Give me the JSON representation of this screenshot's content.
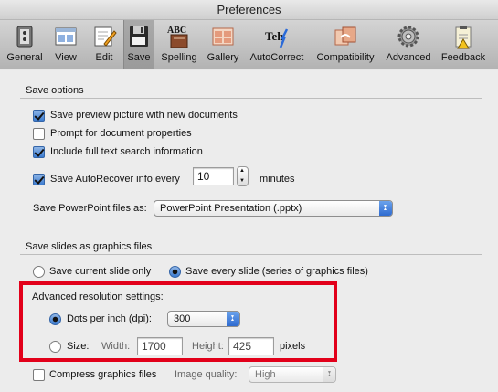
{
  "window": {
    "title": "Preferences"
  },
  "toolbar": {
    "items": [
      {
        "label": "General",
        "icon": "general-icon"
      },
      {
        "label": "View",
        "icon": "view-icon"
      },
      {
        "label": "Edit",
        "icon": "edit-icon"
      },
      {
        "label": "Save",
        "icon": "save-icon",
        "selected": true
      },
      {
        "label": "Spelling",
        "icon": "spelling-icon"
      },
      {
        "label": "Gallery",
        "icon": "gallery-icon"
      },
      {
        "label": "AutoCorrect",
        "icon": "autocorrect-icon"
      },
      {
        "label": "Compatibility",
        "icon": "compatibility-icon"
      },
      {
        "label": "Advanced",
        "icon": "advanced-icon"
      },
      {
        "label": "Feedback",
        "icon": "feedback-icon"
      }
    ],
    "spelling_icon_text": "ABC",
    "autocorrect_icon_text": "Teh"
  },
  "save_options": {
    "title": "Save options",
    "preview": {
      "label": "Save preview picture with new documents",
      "checked": true
    },
    "prompt": {
      "label": "Prompt for document properties",
      "checked": false
    },
    "fulltext": {
      "label": "Include full text search information",
      "checked": true
    },
    "autorecover": {
      "label": "Save AutoRecover info every",
      "checked": true,
      "value": "10",
      "unit": "minutes"
    },
    "format_label": "Save PowerPoint files as:",
    "format_value": "PowerPoint Presentation (.pptx)"
  },
  "graphics": {
    "title": "Save slides as graphics files",
    "current_label": "Save current slide only",
    "every_label": "Save every slide (series of graphics files)",
    "selected": "every",
    "advanced_title": "Advanced resolution settings:",
    "dpi_label": "Dots per inch (dpi):",
    "dpi_value": "300",
    "size_label": "Size:",
    "width_label": "Width:",
    "width_value": "1700",
    "height_label": "Height:",
    "height_value": "425",
    "pixels_label": "pixels",
    "resolution_mode": "dpi",
    "compress_label": "Compress graphics files",
    "compress_checked": false,
    "quality_label": "Image quality:",
    "quality_value": "High"
  },
  "colors": {
    "highlight_border": "#e2001a",
    "accent": "#3b7bd0"
  }
}
